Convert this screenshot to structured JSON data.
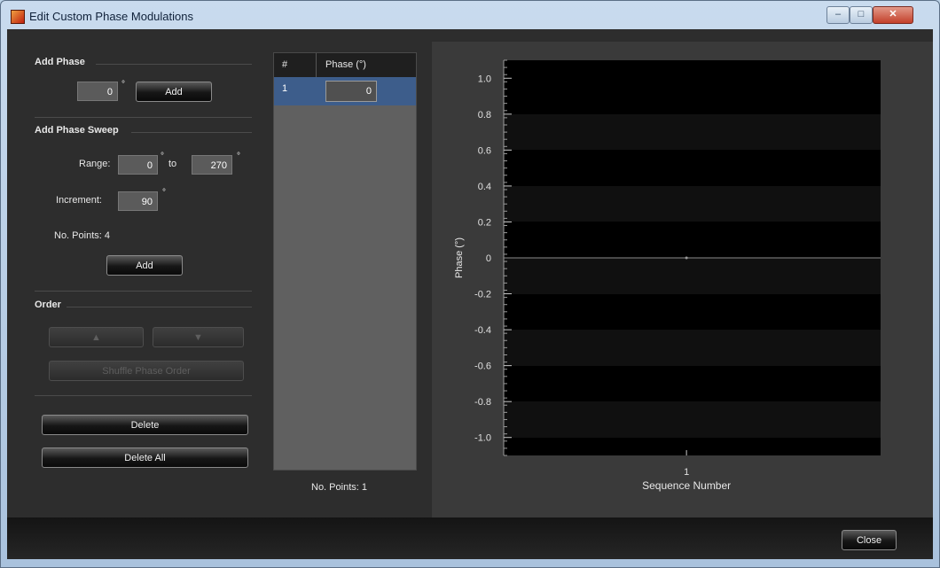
{
  "window": {
    "title": "Edit Custom Phase Modulations",
    "controls": {
      "minimize": "–",
      "maximize": "□",
      "close": "✕"
    }
  },
  "add_phase": {
    "header": "Add Phase",
    "value": "0",
    "unit": "°",
    "add_label": "Add"
  },
  "sweep": {
    "header": "Add Phase Sweep",
    "range_label": "Range:",
    "range_from": "0",
    "to_label": "to",
    "range_to": "270",
    "increment_label": "Increment:",
    "increment": "90",
    "unit": "°",
    "points_label": "No. Points: 4",
    "add_label": "Add"
  },
  "order": {
    "header": "Order",
    "up_label": "▲",
    "down_label": "▼",
    "shuffle_label": "Shuffle Phase Order"
  },
  "delete_label": "Delete",
  "delete_all_label": "Delete All",
  "table": {
    "columns": [
      "#",
      "Phase (°)"
    ],
    "rows": [
      {
        "index": "1",
        "phase": "0"
      }
    ],
    "points_label": "No. Points: 1"
  },
  "chart_data": {
    "type": "line",
    "ylabel": "Phase (°)",
    "xlabel": "Sequence Number",
    "x_ticks": [
      "1"
    ],
    "y_ticks": [
      "1.0",
      "0.8",
      "0.6",
      "0.4",
      "0.2",
      "0",
      "-0.2",
      "-0.4",
      "-0.6",
      "-0.8",
      "-1.0"
    ],
    "ylim": [
      -1.1,
      1.1
    ],
    "background": "#000000",
    "series": [
      {
        "x": [
          1
        ],
        "values": [
          0
        ]
      }
    ]
  },
  "close_label": "Close"
}
